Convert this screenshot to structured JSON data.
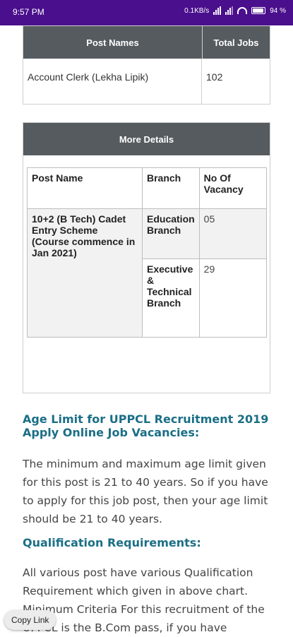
{
  "status_bar": {
    "time": "9:57 PM",
    "network_speed": "0.1KB/s",
    "battery_percent": "94 %",
    "battery_level": 0.94
  },
  "jobs_table": {
    "col_post": "Post Names",
    "col_total": "Total Jobs",
    "rows": [
      {
        "post": "Account Clerk (Lekha Lipik)",
        "total": "102"
      }
    ]
  },
  "details_card": {
    "title": "More Details",
    "headers": [
      "Post Name",
      "Branch",
      "No Of Vacancy"
    ],
    "post_name": "10+2 (B Tech) Cadet Entry Scheme (Course commence in Jan 2021)",
    "branches": [
      {
        "branch": "Education Branch",
        "vacancy": "05"
      },
      {
        "branch": "Executive & Technical Branch",
        "vacancy": "29"
      }
    ]
  },
  "age_section": {
    "heading": "Age Limit for UPPCL Recruitment 2019 Apply Online Job Vacancies:",
    "text": "The minimum and maximum age limit given for this post is 21 to 40 years. So if you have to apply for this job post, then your age limit should be 21 to 40 years."
  },
  "qualification_section": {
    "heading": "Qualification Requirements:",
    "text": "All various post have various Qualification Requirement which given in above chart. Minimum Criteria For this recruitment of the UPPCL is the B.Com pass, if you have"
  },
  "copy_link_label": "Copy Link",
  "colors": {
    "status_bar": "#4a0f8c",
    "table_header": "#565b60",
    "heading_accent": "#1b6f86"
  }
}
